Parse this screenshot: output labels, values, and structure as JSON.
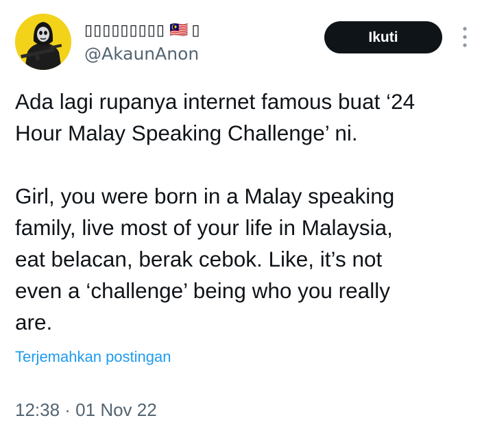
{
  "tweet": {
    "author": {
      "display_name": "𝙰𝚔𝚊𝚞𝚗𝙰𝚗𝚘𝚗",
      "display_name_rendered": "▯▯▯▯▯▯▯▯▯",
      "flag_emoji": "🇲🇾",
      "trailing_glyph": "▯",
      "handle": "@AkaunAnon",
      "avatar_icon": "masked-soldier-avatar-icon"
    },
    "follow_label": "Ikuti",
    "more_icon": "vertical-ellipsis-icon",
    "text_paragraphs": [
      "Ada lagi rupanya internet famous buat ‘24 Hour Malay Speaking Challenge’ ni.",
      "Girl, you were born in a Malay speaking family, live most of your life in Malaysia, eat belacan, berak cebok. Like, it’s not even a ‘challenge’ being who you really are."
    ],
    "text_rendered": "Ada lagi rupanya internet famous buat ‘24\nHour Malay Speaking Challenge’ ni.\n\nGirl, you were born in a Malay speaking\nfamily, live most of your life in Malaysia,\neat belacan, berak cebok. Like, it’s not\neven a ‘challenge’ being who you really\nare.",
    "translate_label": "Terjemahkan postingan",
    "timestamp": "12:38 · 01 Nov 22"
  },
  "colors": {
    "text_primary": "#0f1419",
    "text_secondary": "#536471",
    "link": "#1d9bf0",
    "follow_button_bg": "#0f1419",
    "avatar_bg": "#f3d21a"
  }
}
